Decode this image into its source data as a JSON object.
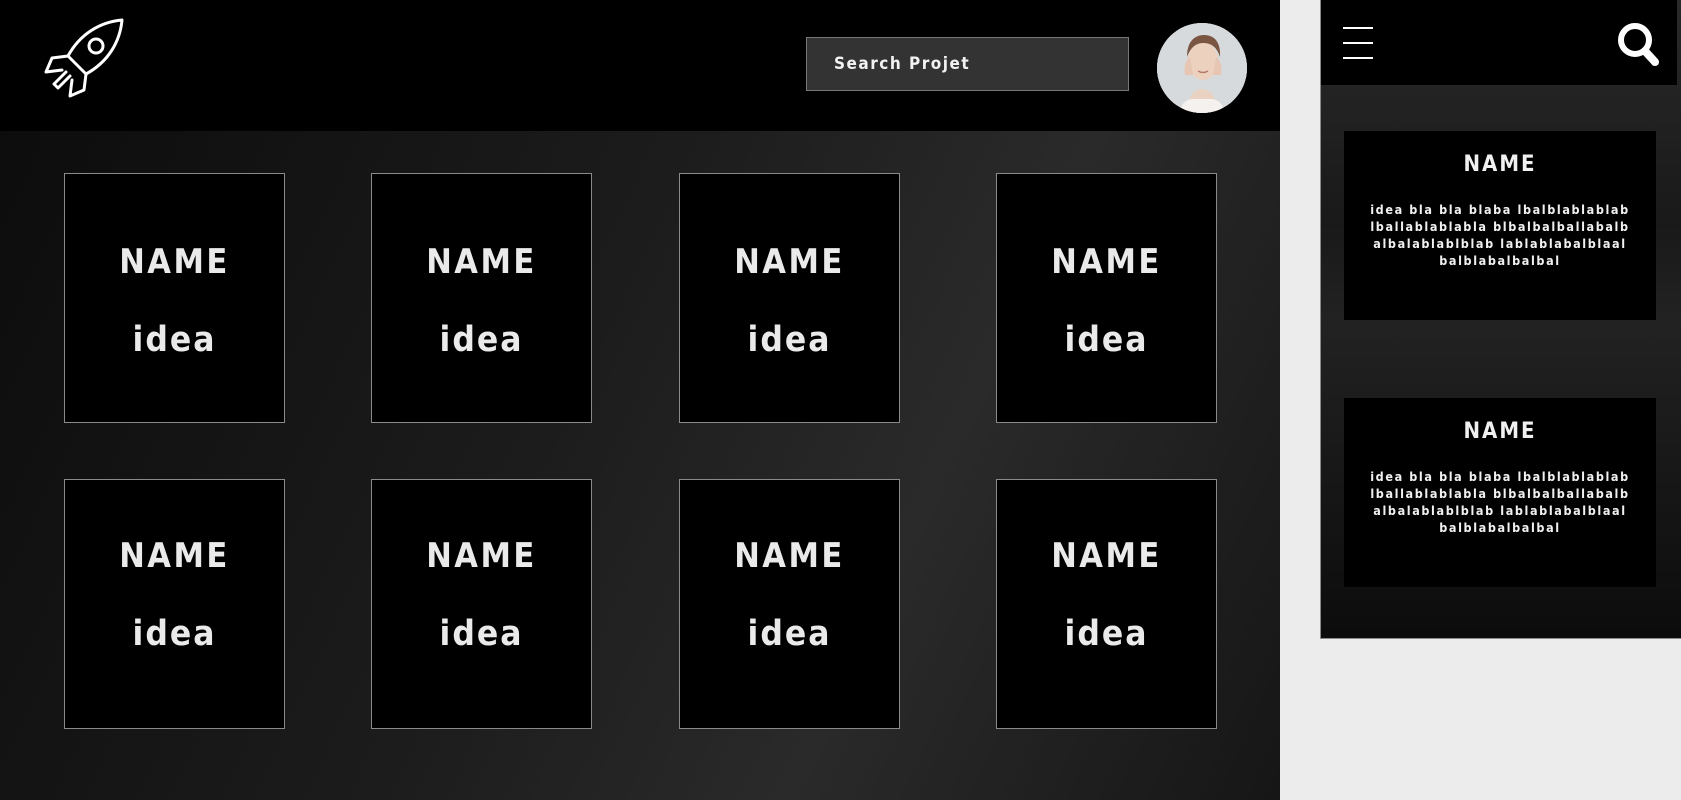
{
  "desktop": {
    "header": {
      "logo_icon": "rocket-icon",
      "search": {
        "placeholder": "Search Projet",
        "value": ""
      },
      "avatar": "user-avatar"
    },
    "cards": [
      {
        "name": "NAME",
        "idea": "idea"
      },
      {
        "name": "NAME",
        "idea": "idea"
      },
      {
        "name": "NAME",
        "idea": "idea"
      },
      {
        "name": "NAME",
        "idea": "idea"
      },
      {
        "name": "NAME",
        "idea": "idea"
      },
      {
        "name": "NAME",
        "idea": "idea"
      },
      {
        "name": "NAME",
        "idea": "idea"
      },
      {
        "name": "NAME",
        "idea": "idea"
      }
    ]
  },
  "mobile": {
    "header": {
      "menu_icon": "hamburger-menu-icon",
      "search_icon": "search-icon"
    },
    "cards": [
      {
        "name": "NAME",
        "description": "idea bla bla blaba lbalblablablablballablablabla blbalbalballabalbalbalablablblab lablablabalblaalbalblabalbalbal"
      },
      {
        "name": "NAME",
        "description": "idea bla bla blaba lbalblablablablballablablabla blbalbalballabalbalbalablablblab lablablabalblaalbalblabalbalbal"
      }
    ]
  },
  "colors": {
    "background": "#000000",
    "text": "#eaeaea",
    "card_border": "#8a8a8a",
    "search_bg": "#333333",
    "page_bg": "#ececec"
  }
}
